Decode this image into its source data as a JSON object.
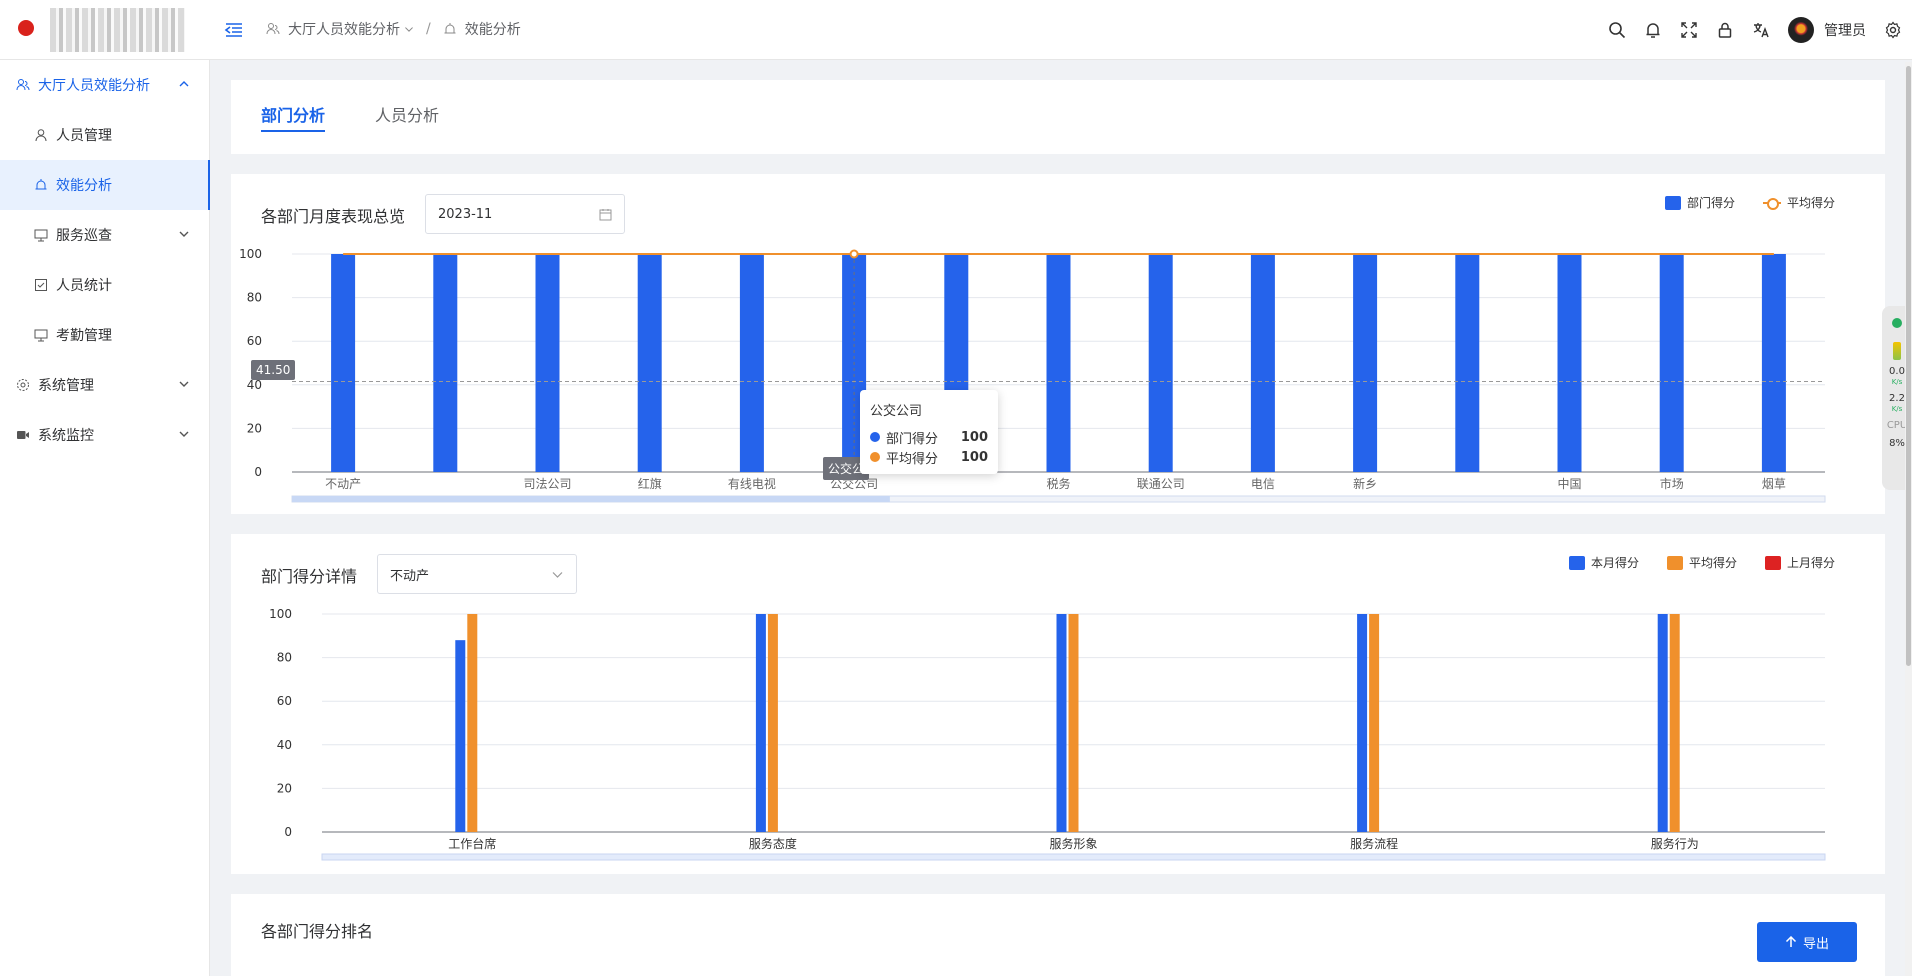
{
  "header": {
    "breadcrumb": [
      "大厅人员效能分析",
      "效能分析"
    ],
    "username": "管理员"
  },
  "sidebar": {
    "items": [
      {
        "label": "大厅人员效能分析",
        "icon": "users-icon",
        "level": "top",
        "state": "open"
      },
      {
        "label": "人员管理",
        "icon": "user-icon",
        "level": "sub"
      },
      {
        "label": "效能分析",
        "icon": "alarm-icon",
        "level": "sub",
        "state": "active"
      },
      {
        "label": "服务巡查",
        "icon": "monitor-icon",
        "level": "sub"
      },
      {
        "label": "人员统计",
        "icon": "checkbox-icon",
        "level": "sub"
      },
      {
        "label": "考勤管理",
        "icon": "monitor-icon",
        "level": "sub"
      },
      {
        "label": "系统管理",
        "icon": "gear-icon",
        "level": "top"
      },
      {
        "label": "系统监控",
        "icon": "video-icon",
        "level": "top"
      }
    ]
  },
  "tabs": [
    {
      "label": "部门分析",
      "active": true
    },
    {
      "label": "人员分析",
      "active": false
    }
  ],
  "card1": {
    "title": "各部门月度表现总览",
    "date_value": "2023-11",
    "legend": [
      "部门得分",
      "平均得分"
    ],
    "pointer_value": "41.50",
    "pointer_category": "公交公",
    "tooltip": {
      "title": "公交公司",
      "rows": [
        {
          "name": "部门得分",
          "value": "100"
        },
        {
          "name": "平均得分",
          "value": "100"
        }
      ]
    }
  },
  "card2": {
    "title": "部门得分详情",
    "select_value": "不动产",
    "legend": [
      "本月得分",
      "平均得分",
      "上月得分"
    ]
  },
  "card3": {
    "title": "各部门得分排名",
    "export_label": "导出"
  },
  "float_panel": {
    "net_down": "0.0",
    "net_down_unit": "K/s",
    "net_up": "2.2",
    "net_up_unit": "K/s",
    "cpu_label": "CPU",
    "cpu_value": "8%"
  },
  "colors": {
    "primary": "#1a63e8",
    "bar_blue": "#2563eb",
    "avg_orange": "#f0902c",
    "last_red": "#dd2222"
  },
  "chart_data": [
    {
      "type": "bar",
      "title": "各部门月度表现总览",
      "categories": [
        "不动产",
        "",
        "司法公司",
        "红旗",
        "有线电视",
        "公交公司",
        "",
        "税务",
        "联通公司",
        "电信",
        "新乡",
        "",
        "中国",
        "市场",
        "烟草"
      ],
      "series": [
        {
          "name": "部门得分",
          "type": "bar",
          "color": "#2563eb",
          "values": [
            100,
            100,
            100,
            100,
            100,
            100,
            100,
            100,
            100,
            100,
            100,
            100,
            100,
            100,
            100
          ]
        },
        {
          "name": "平均得分",
          "type": "line",
          "color": "#f0902c",
          "values": [
            100,
            100,
            100,
            100,
            100,
            100,
            100,
            100,
            100,
            100,
            100,
            100,
            100,
            100,
            100
          ]
        }
      ],
      "ylim": [
        0,
        100
      ],
      "yticks": [
        0,
        20,
        40,
        60,
        80,
        100
      ],
      "grid": true,
      "legend": "top-right"
    },
    {
      "type": "bar",
      "title": "部门得分详情",
      "categories": [
        "工作台席",
        "服务态度",
        "服务形象",
        "服务流程",
        "服务行为"
      ],
      "series": [
        {
          "name": "本月得分",
          "color": "#2563eb",
          "values": [
            88,
            100,
            100,
            100,
            100
          ]
        },
        {
          "name": "平均得分",
          "color": "#f0902c",
          "values": [
            100,
            100,
            100,
            100,
            100
          ]
        },
        {
          "name": "上月得分",
          "color": "#dd2222",
          "values": [
            0,
            0,
            0,
            0,
            0
          ]
        }
      ],
      "ylim": [
        0,
        100
      ],
      "yticks": [
        0,
        20,
        40,
        60,
        80,
        100
      ],
      "grid": true,
      "legend": "top-right"
    }
  ]
}
